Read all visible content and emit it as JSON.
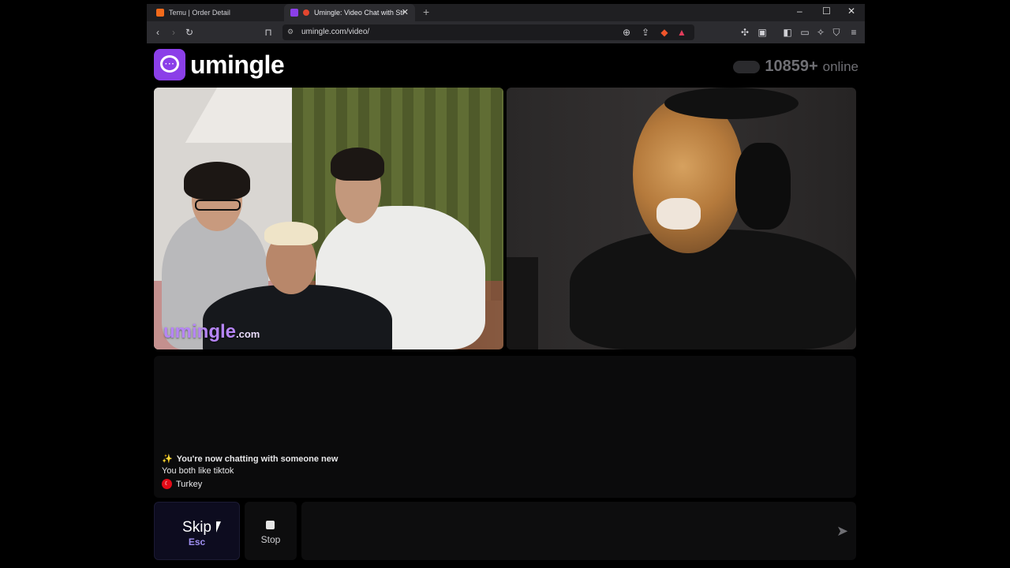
{
  "browser": {
    "tabs": [
      {
        "title": "Temu | Order Detail",
        "active": false,
        "favicon_color": "#f26a1b"
      },
      {
        "title": "Umingle: Video Chat with Str",
        "active": true,
        "favicon_color": "#8b3fe8"
      }
    ],
    "url": "umingle.com/video/",
    "window_controls": {
      "minimize": "–",
      "maximize": "☐",
      "close": "✕"
    },
    "new_tab": "+"
  },
  "header": {
    "logo_text": "umingle",
    "online_count": "10859+",
    "online_label": "online"
  },
  "video": {
    "watermark_main": "umingle",
    "watermark_suffix": ".com"
  },
  "chat": {
    "messages": [
      {
        "icon": "✨",
        "text": "You're now chatting with someone new"
      },
      {
        "text": "You both like tiktok"
      },
      {
        "icon": "flag-turkey",
        "text": "Turkey"
      }
    ]
  },
  "controls": {
    "skip_label": "Skip",
    "skip_key": "Esc",
    "stop_label": "Stop",
    "message_placeholder": ""
  },
  "colors": {
    "brand": "#8b3fe8",
    "skip_key": "#9f8ff0"
  }
}
